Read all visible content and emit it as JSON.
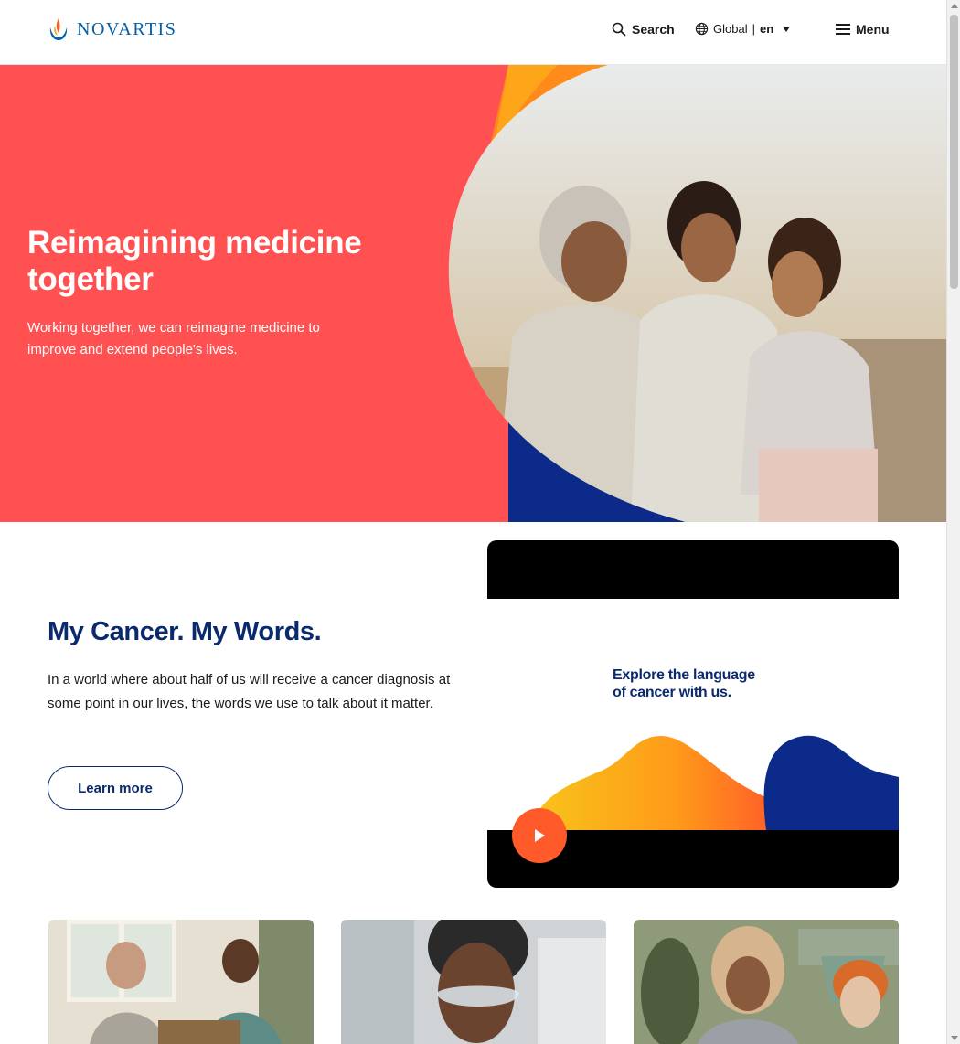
{
  "header": {
    "logo_text": "NOVARTIS",
    "search_label": "Search",
    "region_label": "Global",
    "separator": "|",
    "language": "en",
    "menu_label": "Menu"
  },
  "hero": {
    "title": "Reimagining medicine together",
    "subtitle": "Working together, we can reimagine medicine to improve and extend people's lives."
  },
  "feature": {
    "title": "My Cancer. My Words.",
    "text": "In a world where about half of us will receive a cancer diagnosis at some point in our lives, the words we use to talk about it matter.",
    "button_label": "Learn more"
  },
  "video": {
    "caption_line1": "Explore the language",
    "caption_line2": "of cancer with us."
  },
  "colors": {
    "brand_blue": "#0460a9",
    "navy": "#0b2a6e",
    "hero_red": "#ff5151",
    "orange": "#ff5a2a"
  }
}
